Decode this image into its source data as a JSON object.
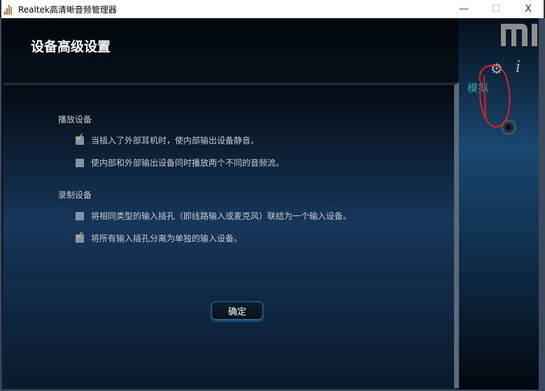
{
  "window": {
    "title": "Realtek高清晰音频管理器",
    "minimize": "—",
    "maximize": "☐",
    "close": "X"
  },
  "header": {
    "title": "设备高级设置",
    "logo": "MI"
  },
  "sidebar": {
    "analog_label": "模拟"
  },
  "playback": {
    "heading": "播放设备",
    "options": [
      {
        "label": "当插入了外部耳机时，使内部输出设备静音。",
        "checked": true
      },
      {
        "label": "使内部和外部输出设备同时播放两个不同的音频流。",
        "checked": false
      }
    ]
  },
  "recording": {
    "heading": "录制设备",
    "options": [
      {
        "label": "将相同类型的输入插孔（即线路输入或麦克风）联结为一个输入设备。",
        "checked": false
      },
      {
        "label": "将所有输入插孔分离为单独的输入设备。",
        "checked": true
      }
    ]
  },
  "ok_label": "确定"
}
